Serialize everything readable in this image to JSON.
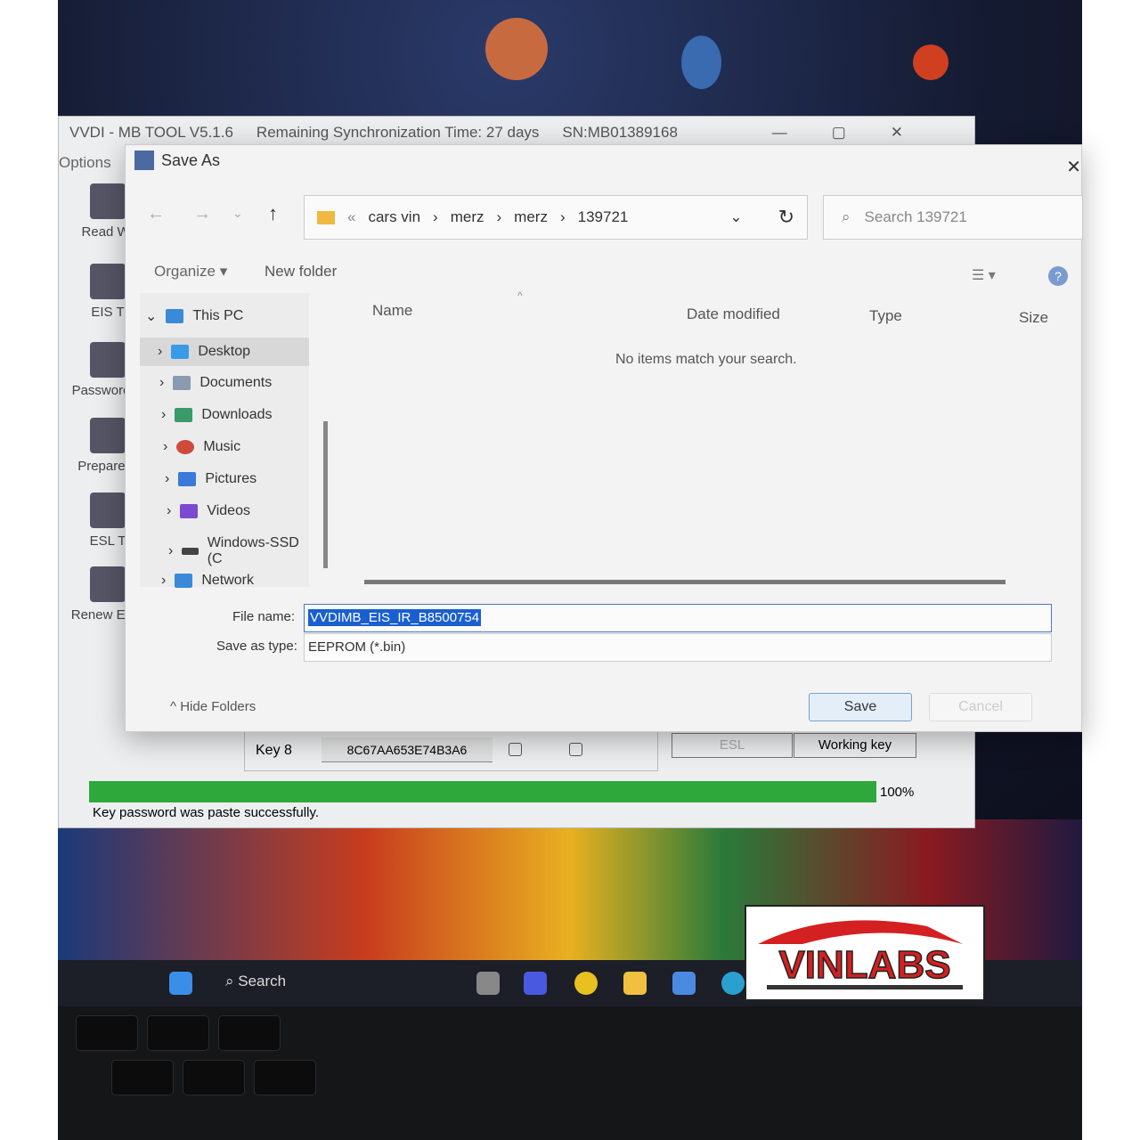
{
  "app": {
    "title": "VVDI - MB TOOL V5.1.6",
    "sync": "Remaining Synchronization Time: 27 days",
    "serial": "SN:MB01389168",
    "menu_options": "Options",
    "sidebar": [
      "Read Wr",
      "EIS T",
      "Password C",
      "Prepare K",
      "ESL T",
      "Renew ECU"
    ],
    "key_row": {
      "label": "Key 8",
      "value": "8C67AA653E74B3A6"
    },
    "buttons": {
      "esl": "ESL",
      "working_key": "Working key"
    },
    "progress": {
      "percent": 100,
      "label": "100%",
      "color": "#2ea83a"
    },
    "status": "Key password was paste successfully."
  },
  "dialog": {
    "title": "Save As",
    "breadcrumb": [
      "cars vin",
      "merz",
      "merz",
      "139721"
    ],
    "search_placeholder": "Search 139721",
    "toolbar": {
      "organize": "Organize",
      "new_folder": "New folder"
    },
    "nav": [
      "This PC",
      "Desktop",
      "Documents",
      "Downloads",
      "Music",
      "Pictures",
      "Videos",
      "Windows-SSD (C",
      "Network"
    ],
    "columns": [
      "Name",
      "Date modified",
      "Type",
      "Size"
    ],
    "empty": "No items match your search.",
    "file_name_label": "File name:",
    "file_name": "VVDIMB_EIS_IR_B8500754",
    "save_type_label": "Save as type:",
    "save_type": "EEPROM (*.bin)",
    "hide_folders": "Hide Folders",
    "save": "Save",
    "cancel": "Cancel"
  },
  "taskbar": {
    "search": "Search"
  },
  "watermark": "VINLABS"
}
